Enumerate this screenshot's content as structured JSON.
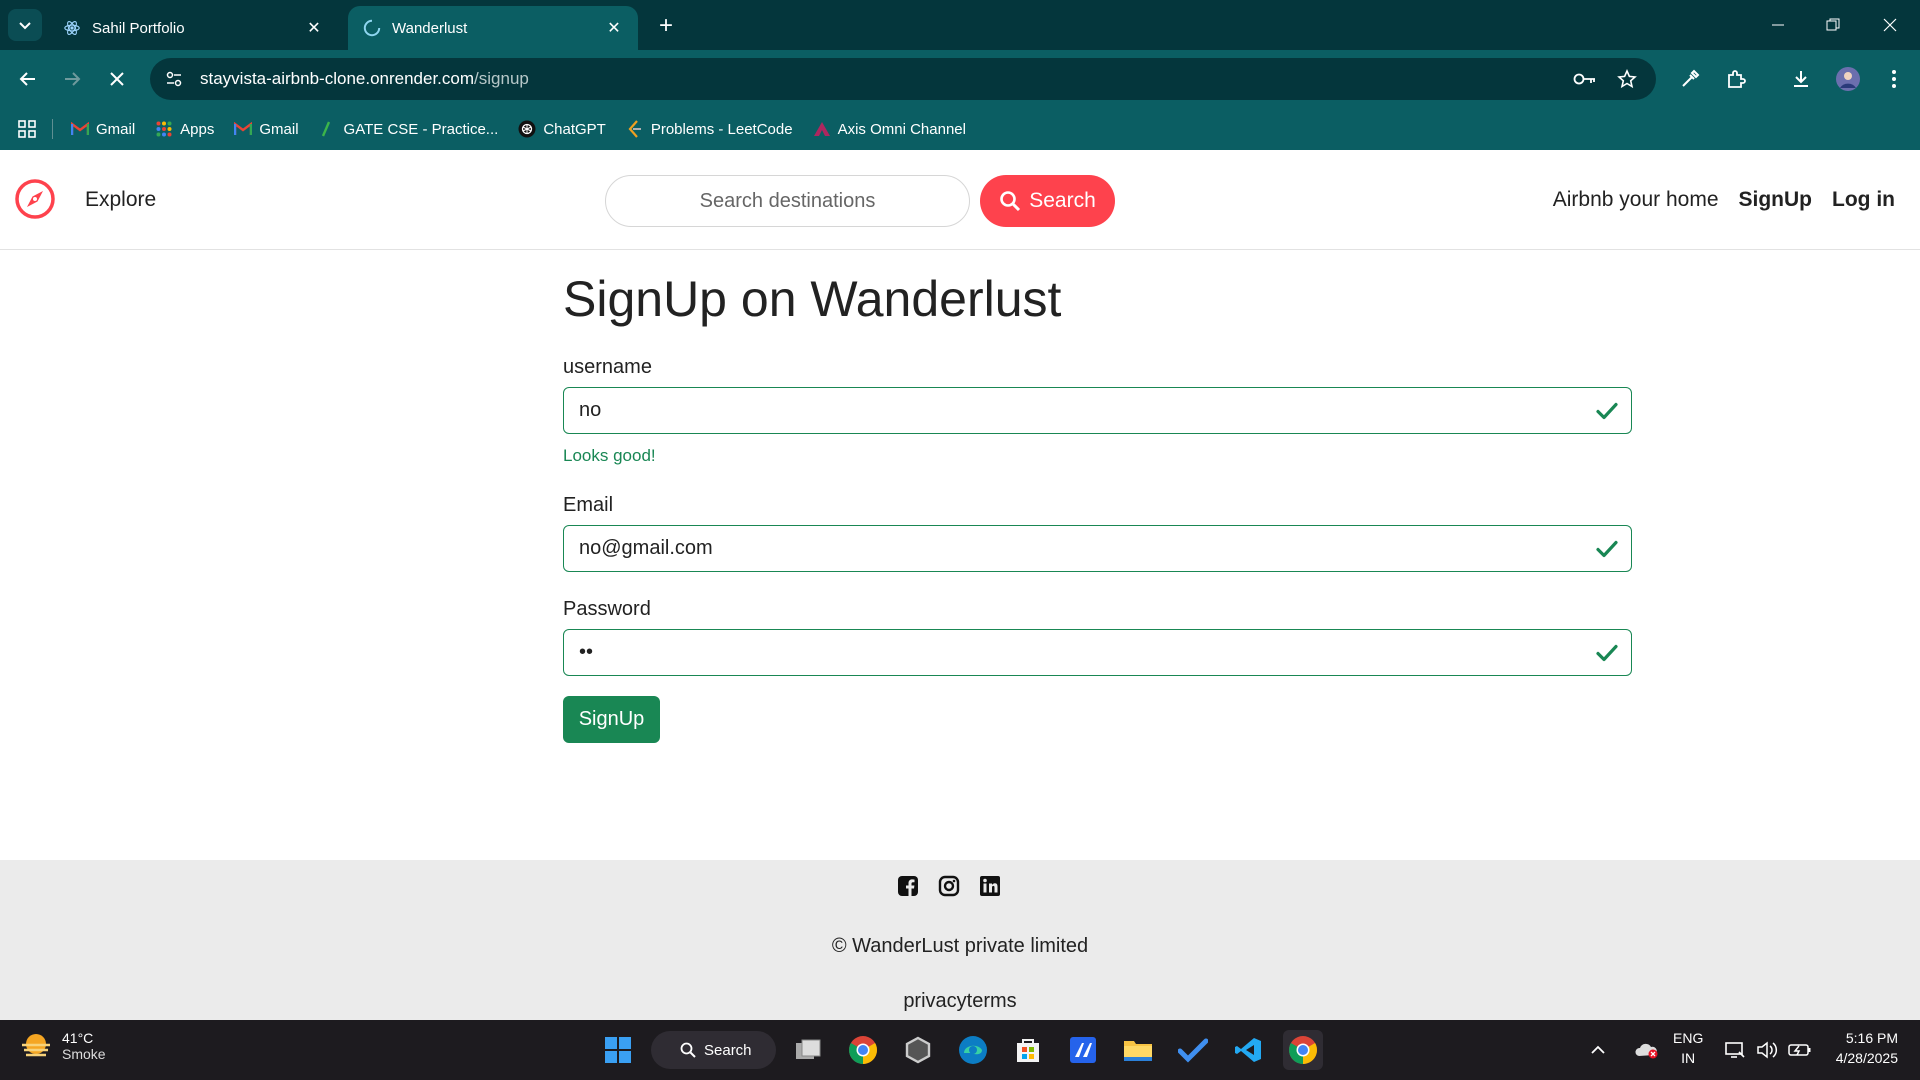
{
  "browser": {
    "tabs": [
      {
        "title": "Sahil Portfolio",
        "favicon": "react-icon",
        "active": false
      },
      {
        "title": "Wanderlust",
        "favicon": "loading-spinner-icon",
        "active": true
      }
    ],
    "url_host": "stayvista-airbnb-clone.onrender.com",
    "url_path": "/signup",
    "bookmarks": [
      {
        "label": "Gmail",
        "icon": "gmail-icon"
      },
      {
        "label": "Apps",
        "icon": "apps-grid-icon"
      },
      {
        "label": "Gmail",
        "icon": "gmail-icon"
      },
      {
        "label": "GATE CSE - Practice...",
        "icon": "gate-icon"
      },
      {
        "label": "ChatGPT",
        "icon": "chatgpt-icon"
      },
      {
        "label": "Problems - LeetCode",
        "icon": "leetcode-icon"
      },
      {
        "label": "Axis Omni Channel",
        "icon": "axis-icon"
      }
    ]
  },
  "site": {
    "nav": {
      "explore": "Explore",
      "search_placeholder": "Search destinations",
      "search_button": "Search",
      "airbnb_home": "Airbnb your home",
      "signup": "SignUp",
      "login": "Log in"
    },
    "form": {
      "title": "SignUp on Wanderlust",
      "username_label": "username",
      "username_value": "no",
      "username_feedback": "Looks good!",
      "email_label": "Email",
      "email_value": "no@gmail.com",
      "password_label": "Password",
      "password_value": "no",
      "submit": "SignUp"
    },
    "footer": {
      "socials": [
        "facebook-icon",
        "instagram-icon",
        "linkedin-icon"
      ],
      "copyright": "© WanderLust private limited",
      "links": "privacyterms"
    }
  },
  "taskbar": {
    "weather_temp": "41°C",
    "weather_cond": "Smoke",
    "search_label": "Search",
    "lang_line1": "ENG",
    "lang_line2": "IN",
    "time": "5:16 PM",
    "date": "4/28/2025"
  },
  "colors": {
    "chrome_dark": "#04363c",
    "chrome_toolbar": "#0b5e63",
    "brand_red": "#fe424d",
    "success_green": "#198754",
    "footer_bg": "#ebebeb"
  }
}
